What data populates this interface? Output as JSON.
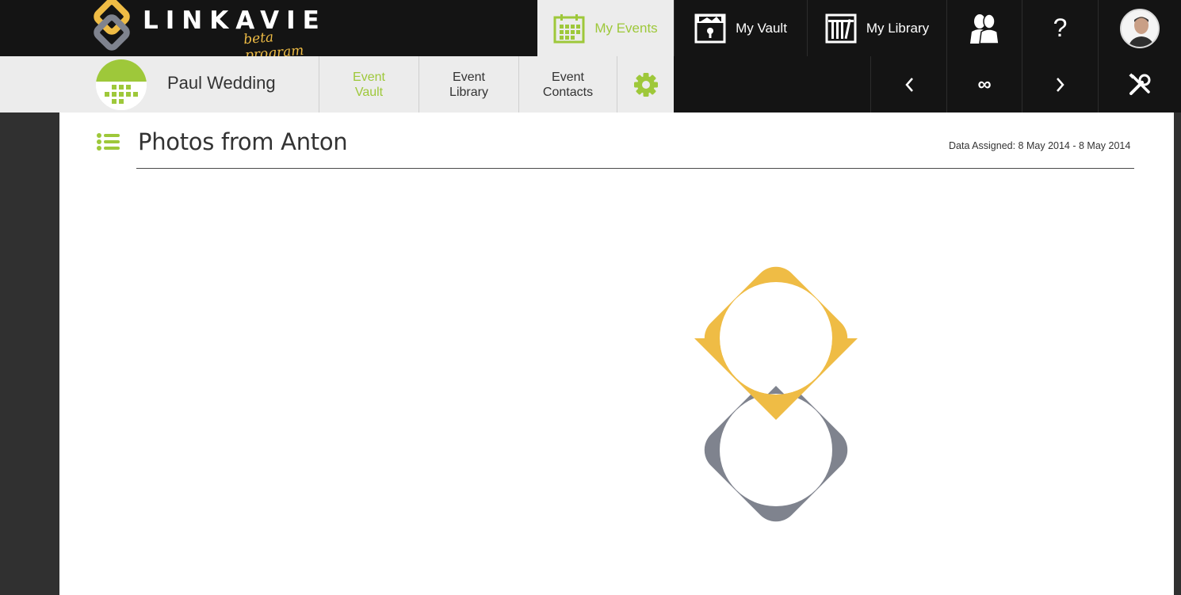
{
  "brand": {
    "name": "LINKAVIE",
    "tagline": "beta program",
    "colors": {
      "yellow": "#efbc45",
      "gray": "#7f838e",
      "accent_green": "#9ec83a",
      "dark": "#141414"
    }
  },
  "topnav": {
    "my_events": "My Events",
    "my_vault": "My Vault",
    "my_library": "My Library",
    "help": "?",
    "people_icon": "people-icon",
    "profile_icon": "avatar"
  },
  "event": {
    "title": "Paul Wedding",
    "tabs": {
      "vault_line1": "Event",
      "vault_line2": "Vault",
      "library_line1": "Event",
      "library_line2": "Library",
      "contacts_line1": "Event",
      "contacts_line2": "Contacts"
    },
    "active_tab": "Event Vault"
  },
  "toolbar": {
    "prev_icon": "chevron-left-icon",
    "loop_label": "∞",
    "next_icon": "chevron-right-icon",
    "tools_icon": "tools-icon"
  },
  "page": {
    "title": "Photos from Anton",
    "date_assigned": "Data Assigned: 8 May 2014 - 8 May 2014"
  }
}
